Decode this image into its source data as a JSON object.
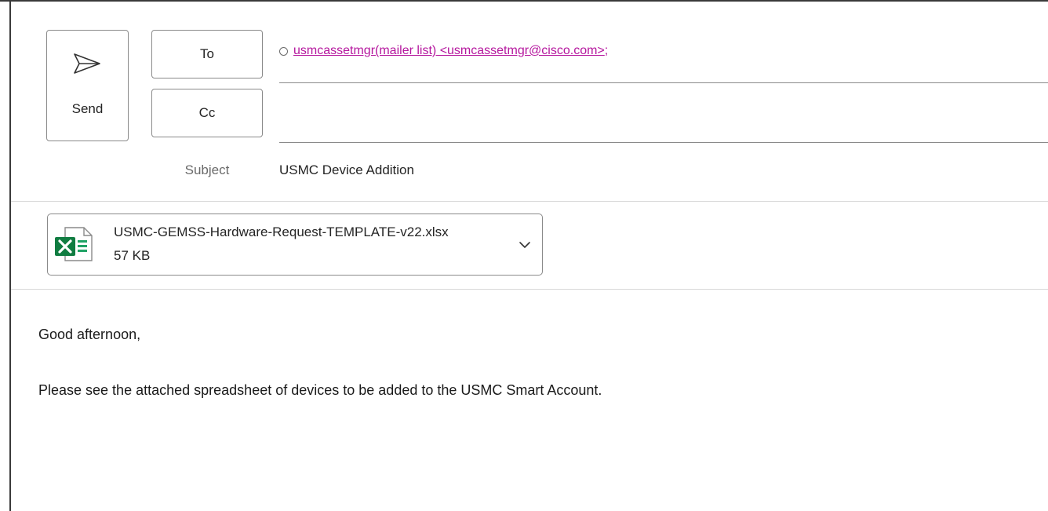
{
  "compose": {
    "send_label": "Send",
    "to_label": "To",
    "cc_label": "Cc",
    "to_recipients": [
      {
        "display": "usmcassetmgr(mailer list) <usmcassetmgr@cisco.com>",
        "separator": ";"
      }
    ],
    "cc_recipients": [],
    "subject_label": "Subject",
    "subject_value": "USMC Device Addition"
  },
  "attachment": {
    "file_name": "USMC-GEMSS-Hardware-Request-TEMPLATE-v22.xlsx",
    "file_size": "57 KB",
    "icon": "excel-file-icon"
  },
  "body": {
    "greeting": "Good afternoon,",
    "message": "Please see the attached spreadsheet of devices to be added to the USMC Smart Account."
  },
  "colors": {
    "recipient_link": "#b5179e",
    "excel_green": "#107c41",
    "border": "#8a8a8a"
  }
}
